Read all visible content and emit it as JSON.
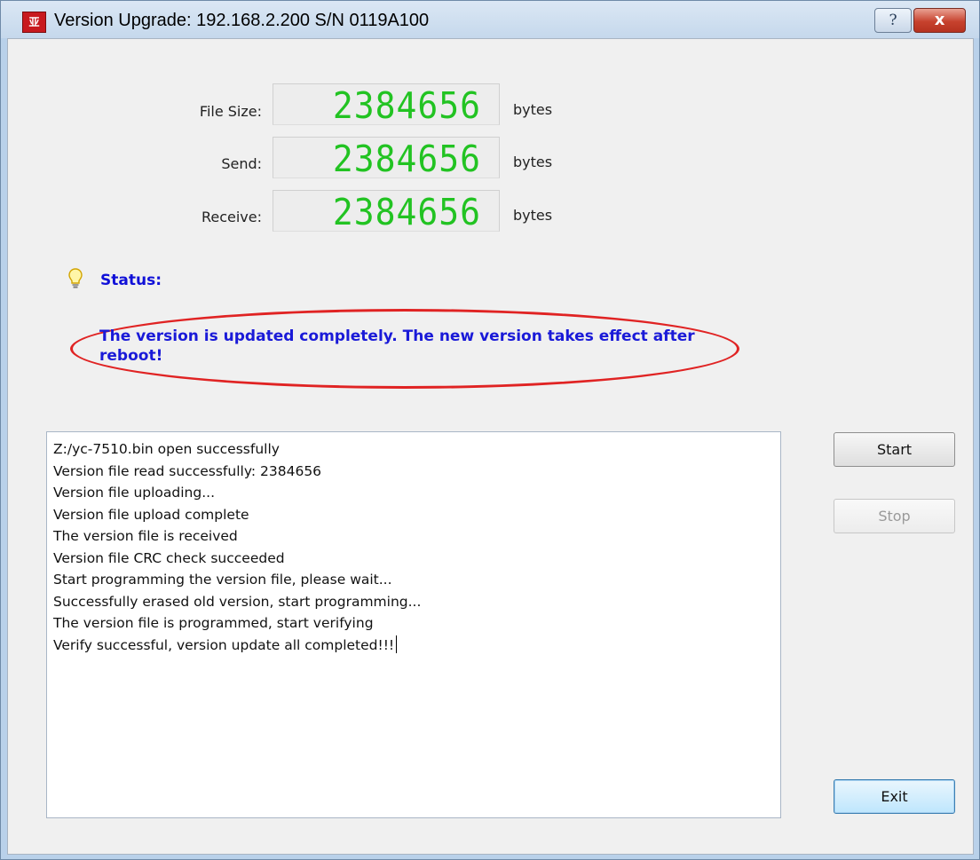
{
  "window": {
    "app_icon_text": "亚",
    "title": "Version Upgrade: 192.168.2.200  S/N 0119A100",
    "help_symbol": "?",
    "close_symbol": "x"
  },
  "counters": [
    {
      "label": "File Size:",
      "value": "2384656",
      "unit": "bytes"
    },
    {
      "label": "Send:",
      "value": "2384656",
      "unit": "bytes"
    },
    {
      "label": "Receive:",
      "value": "2384656",
      "unit": "bytes"
    }
  ],
  "status": {
    "label": "Status:",
    "message": "The version is updated completely. The new version takes effect after reboot!"
  },
  "log_lines": [
    "Z:/yc-7510.bin open successfully",
    "Version file read successfully: 2384656",
    "Version file uploading...",
    "Version file upload complete",
    "The version file is received",
    "Version file CRC check succeeded",
    "Start programming the version file, please wait...",
    "Successfully erased old version, start programming...",
    "The version file is programmed, start verifying",
    "Verify successful, version update all completed!!!"
  ],
  "buttons": {
    "start": "Start",
    "stop": "Stop",
    "exit": "Exit"
  },
  "colors": {
    "lcd_digits": "#22c322",
    "status_text": "#1a1ad8",
    "highlight_ellipse": "#e02323"
  }
}
